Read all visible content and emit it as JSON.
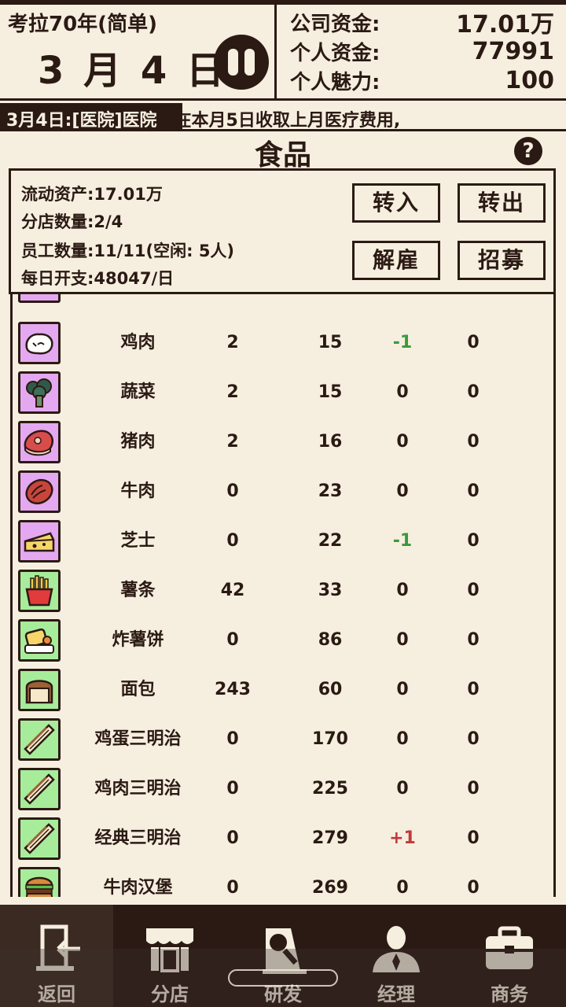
{
  "header": {
    "game_title": "考拉70年(简单)",
    "date": {
      "month": "3",
      "month_unit": "月",
      "day": "4",
      "day_unit": "日"
    },
    "stats": [
      {
        "label": "公司资金:",
        "value": "17.01万"
      },
      {
        "label": "个人资金:",
        "value": "77991"
      },
      {
        "label": "个人魅力:",
        "value": "100"
      }
    ]
  },
  "ticker": {
    "highlight": "3月4日:[医院]医院",
    "text": "3月4日:[医院]医院会在本月5日收取上月医疗费用,"
  },
  "section": {
    "title": "食品",
    "info": {
      "liquid_assets": "流动资产:17.01万",
      "branch_count": "分店数量:2/4",
      "staff_count": "员工数量:11/11(空闲: 5人)",
      "daily_cost": "每日开支:48047/日"
    },
    "buttons": {
      "transfer_in": "转入",
      "transfer_out": "转出",
      "fire": "解雇",
      "recruit": "招募"
    }
  },
  "items": [
    {
      "name": "鸡肉",
      "a": "2",
      "b": "15",
      "c": "-1",
      "d": "0",
      "icon": "chicken-icon",
      "bg": "purple"
    },
    {
      "name": "蔬菜",
      "a": "2",
      "b": "15",
      "c": "0",
      "d": "0",
      "icon": "broccoli-icon",
      "bg": "purple"
    },
    {
      "name": "猪肉",
      "a": "2",
      "b": "16",
      "c": "0",
      "d": "0",
      "icon": "pork-icon",
      "bg": "purple"
    },
    {
      "name": "牛肉",
      "a": "0",
      "b": "23",
      "c": "0",
      "d": "0",
      "icon": "beef-icon",
      "bg": "purple"
    },
    {
      "name": "芝士",
      "a": "0",
      "b": "22",
      "c": "-1",
      "d": "0",
      "icon": "cheese-icon",
      "bg": "purple"
    },
    {
      "name": "薯条",
      "a": "42",
      "b": "33",
      "c": "0",
      "d": "0",
      "icon": "fries-icon",
      "bg": "green"
    },
    {
      "name": "炸薯饼",
      "a": "0",
      "b": "86",
      "c": "0",
      "d": "0",
      "icon": "hashbrown-icon",
      "bg": "green"
    },
    {
      "name": "面包",
      "a": "243",
      "b": "60",
      "c": "0",
      "d": "0",
      "icon": "bread-icon",
      "bg": "green"
    },
    {
      "name": "鸡蛋三明治",
      "a": "0",
      "b": "170",
      "c": "0",
      "d": "0",
      "icon": "sandwich-icon",
      "bg": "green"
    },
    {
      "name": "鸡肉三明治",
      "a": "0",
      "b": "225",
      "c": "0",
      "d": "0",
      "icon": "sandwich-icon",
      "bg": "green"
    },
    {
      "name": "经典三明治",
      "a": "0",
      "b": "279",
      "c": "+1",
      "d": "0",
      "icon": "sandwich-icon",
      "bg": "green"
    },
    {
      "name": "牛肉汉堡",
      "a": "0",
      "b": "269",
      "c": "0",
      "d": "0",
      "icon": "burger-icon",
      "bg": "green"
    }
  ],
  "nav": [
    {
      "label": "返回",
      "icon": "exit-icon"
    },
    {
      "label": "分店",
      "icon": "shop-icon"
    },
    {
      "label": "研发",
      "icon": "research-icon"
    },
    {
      "label": "经理",
      "icon": "manager-icon"
    },
    {
      "label": "商务",
      "icon": "briefcase-icon"
    }
  ],
  "colors": {
    "background": "#f6efdf",
    "ink": "#2b1a14",
    "purple_icon_bg": "#e4a8f0",
    "green_icon_bg": "#a7ec9a",
    "negative": "#3b9a3b",
    "positive": "#c0393b"
  }
}
